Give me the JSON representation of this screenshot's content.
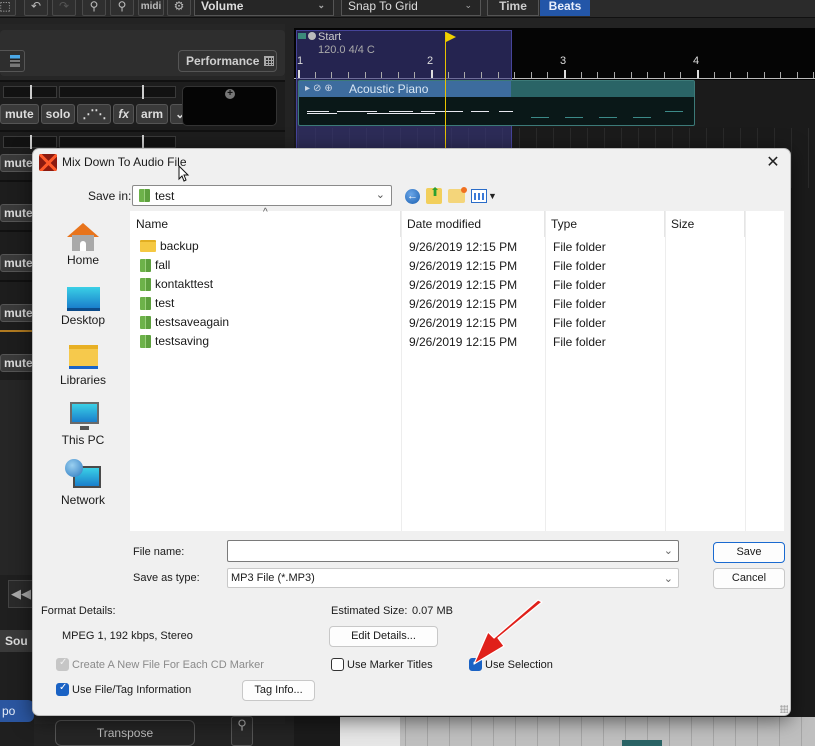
{
  "daw": {
    "toolbar": {
      "midi_label": "midi",
      "automation_select": "Volume",
      "snap_select": "Snap To Grid",
      "tabs": [
        {
          "label": "Time",
          "active": false
        },
        {
          "label": "Beats",
          "active": true
        }
      ]
    },
    "track_panel": {
      "performance_button": "Performance",
      "track_buttons": [
        "mute",
        "solo",
        "fx",
        "arm"
      ],
      "mute_label": "mute"
    },
    "timeline": {
      "start_marker": "Start",
      "tempo_info": "120.0 4/4 C",
      "bar_numbers": [
        "1",
        "2",
        "3",
        "4"
      ],
      "clip_title": "Acoustic Piano"
    },
    "bottom": {
      "sound_tab": "Sou",
      "tempo_button": "po",
      "transpose_button": "Transpose"
    }
  },
  "dialog": {
    "title": "Mix Down To Audio File",
    "save_in_label": "Save in:",
    "save_in_value": "test",
    "places": [
      {
        "label": "Home",
        "icon": "home-icon"
      },
      {
        "label": "Desktop",
        "icon": "desktop-icon"
      },
      {
        "label": "Libraries",
        "icon": "libraries-icon"
      },
      {
        "label": "This PC",
        "icon": "this-pc-icon"
      },
      {
        "label": "Network",
        "icon": "network-icon"
      }
    ],
    "columns": [
      "Name",
      "Date modified",
      "Type",
      "Size"
    ],
    "files": [
      {
        "name": "backup",
        "date": "9/26/2019 12:15 PM",
        "type": "File folder",
        "size": "",
        "icon": "folder-yellow"
      },
      {
        "name": "fall",
        "date": "9/26/2019 12:15 PM",
        "type": "File folder",
        "size": "",
        "icon": "folder-green"
      },
      {
        "name": "kontakttest",
        "date": "9/26/2019 12:15 PM",
        "type": "File folder",
        "size": "",
        "icon": "folder-green"
      },
      {
        "name": "test",
        "date": "9/26/2019 12:15 PM",
        "type": "File folder",
        "size": "",
        "icon": "folder-green"
      },
      {
        "name": "testsaveagain",
        "date": "9/26/2019 12:15 PM",
        "type": "File folder",
        "size": "",
        "icon": "folder-green"
      },
      {
        "name": "testsaving",
        "date": "9/26/2019 12:15 PM",
        "type": "File folder",
        "size": "",
        "icon": "folder-green"
      }
    ],
    "file_name_label": "File name:",
    "file_name_value": "",
    "save_as_type_label": "Save as type:",
    "save_as_type_value": "MP3 File (*.MP3)",
    "save_button": "Save",
    "cancel_button": "Cancel",
    "format_details_label": "Format Details:",
    "format_details_value": "MPEG 1, 192 kbps, Stereo",
    "estimated_size_label": "Estimated Size:",
    "estimated_size_value": "0.07 MB",
    "edit_details_button": "Edit Details...",
    "tag_info_button": "Tag Info...",
    "checkboxes": {
      "create_new_file": {
        "label": "Create A New File For Each CD Marker",
        "checked": true,
        "disabled": true
      },
      "use_file_tag": {
        "label": "Use File/Tag Information",
        "checked": true,
        "disabled": false
      },
      "use_marker_titles": {
        "label": "Use Marker Titles",
        "checked": false,
        "disabled": false
      },
      "use_selection": {
        "label": "Use Selection",
        "checked": true,
        "disabled": false
      }
    },
    "annotation_color": "#e0201a"
  }
}
